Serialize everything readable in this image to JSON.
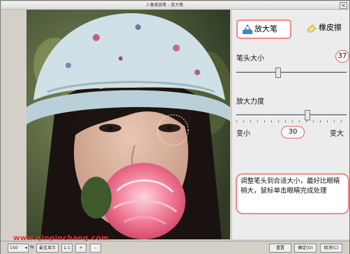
{
  "window": {
    "title": "人像美容笔 - 放大笔"
  },
  "tools": {
    "enlarge_label": "放大笔",
    "eraser_label": "橡皮擦"
  },
  "brush_size": {
    "label": "笔头大小",
    "value": "37"
  },
  "strength": {
    "label": "放大力度",
    "min_label": "变小",
    "value": "30",
    "max_label": "变大"
  },
  "hint": {
    "text": "调整笔头到合适大小，最好比眼睛稍大，鼠标单击眼睛完成处理"
  },
  "watermark": {
    "text": "www.qinpinchang.com"
  },
  "statusbar": {
    "zoom_value": "150",
    "zoom_unit": "%",
    "best_fit_label": "最佳显示",
    "actual_label": "1:1",
    "zoom_in_label": "+",
    "zoom_out_label": "-",
    "reset_label": "重置",
    "ok_label": "确定(O)",
    "cancel_label": "取消(C)"
  },
  "slider_levels": {
    "brush_size": 0.37,
    "strength": 0.65
  },
  "colors": {
    "highlight_border": "#f08a8a",
    "value_oval": "#e36a6a",
    "watermark": "#e43030"
  }
}
